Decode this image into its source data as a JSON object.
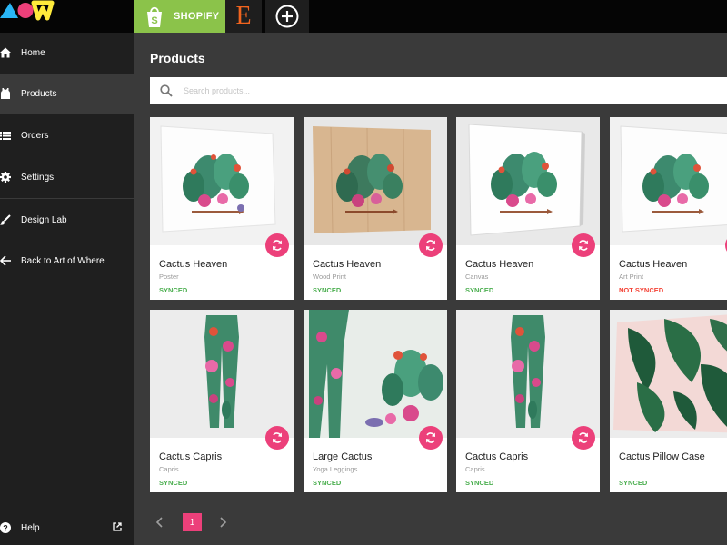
{
  "topbar": {
    "logo_icon": "art-of-where-logo-icon",
    "channels": [
      {
        "label": "SHOPIFY",
        "icon": "shopify-bag-icon",
        "color": "#8bc34a"
      },
      {
        "label": "E",
        "icon": "etsy-logo-icon",
        "color": "#f1641e"
      },
      {
        "icon": "add-channel-icon"
      }
    ]
  },
  "sidebar": {
    "items": [
      {
        "label": "Home",
        "icon": "home-icon"
      },
      {
        "label": "Products",
        "icon": "tank-top-icon",
        "active": true
      },
      {
        "label": "Orders",
        "icon": "list-icon"
      },
      {
        "label": "Settings",
        "icon": "gear-icon"
      },
      {
        "label": "Design Lab",
        "icon": "brush-icon"
      },
      {
        "label": "Back to Art of Where",
        "icon": "arrow-left-icon"
      }
    ],
    "help": {
      "label": "Help",
      "icon": "help-icon",
      "external_icon": "external-link-icon"
    }
  },
  "main": {
    "title": "Products",
    "search": {
      "placeholder": "Search products...",
      "value": ""
    },
    "products": [
      {
        "name": "Cactus Heaven",
        "type": "Poster",
        "status": "SYNCED",
        "image": "cactus-poster"
      },
      {
        "name": "Cactus Heaven",
        "type": "Wood Print",
        "status": "SYNCED",
        "image": "cactus-wood-print"
      },
      {
        "name": "Cactus Heaven",
        "type": "Canvas",
        "status": "SYNCED",
        "image": "cactus-canvas"
      },
      {
        "name": "Cactus Heaven",
        "type": "Art Print",
        "status": "NOT SYNCED",
        "image": "cactus-art-print"
      },
      {
        "name": "Cactus Capris",
        "type": "Capris",
        "status": "SYNCED",
        "image": "cactus-capris"
      },
      {
        "name": "Large Cactus",
        "type": "Yoga Leggings",
        "status": "SYNCED",
        "image": "cactus-yoga-leggings"
      },
      {
        "name": "Cactus Capris",
        "type": "Capris",
        "status": "SYNCED",
        "image": "cactus-capris"
      },
      {
        "name": "Cactus Pillow Case",
        "type": "",
        "status": "SYNCED",
        "image": "monstera-pillow-case"
      }
    ],
    "pagination": {
      "current": "1"
    }
  },
  "colors": {
    "accent": "#ec407a",
    "synced": "#4caf50",
    "not_synced": "#f44336",
    "sidebar_bg": "#1f1f1f",
    "main_bg": "#3a3a3a"
  }
}
